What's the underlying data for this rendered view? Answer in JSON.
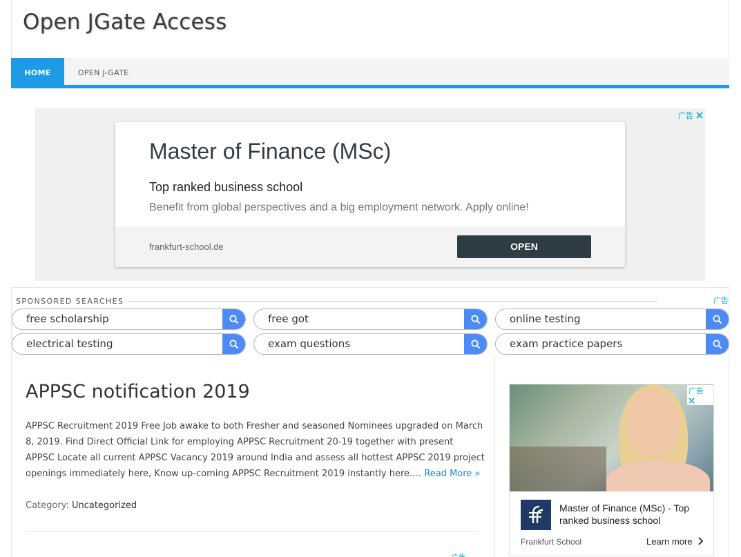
{
  "site": {
    "title": "Open JGate Access"
  },
  "nav": {
    "items": [
      {
        "label": "HOME",
        "active": true
      },
      {
        "label": "OPEN J-GATE",
        "active": false
      }
    ]
  },
  "top_ad": {
    "badge": "广告",
    "headline": "Master of Finance (MSc)",
    "subtitle": "Top ranked business school",
    "description": "Benefit from global perspectives and a big employment network. Apply online!",
    "domain": "frankfurt-school.de",
    "button": "OPEN"
  },
  "sponsored": {
    "label": "SPONSORED SEARCHES",
    "badge": "广告",
    "searches": [
      "free scholarship",
      "free got",
      "online testing",
      "electrical testing",
      "exam questions",
      "exam practice papers"
    ]
  },
  "post": {
    "title": "APPSC notification 2019",
    "excerpt": "APPSC Recruitment 2019 Free Job awake to both Fresher and seasoned Nominees upgraded on March 8, 2019. Find Direct Official Link for employing APPSC Recruitment 20-19 together with present APPSC Locate all current APPSC Vacancy 2019 around India and assess all hottest APPSC 2019 project openings immediately here, Know up-coming APPSC Recruitment 2019 instantly here.… ",
    "read_more": "Read More »",
    "category_label": "Category:",
    "category_value": "Uncategorized"
  },
  "sidebar_ad": {
    "badge": "广告",
    "title": "Master of Finance (MSc) - Top ranked business school",
    "brand": "Frankfurt School",
    "cta": "Learn more"
  },
  "bottom_ad": {
    "badge": "广告"
  },
  "colors": {
    "accent": "#1e9be6",
    "ad_badge": "#00aecd",
    "search_button": "#4c8bf5",
    "ad_open_button": "#2e3c44",
    "link": "#1e88d4"
  }
}
